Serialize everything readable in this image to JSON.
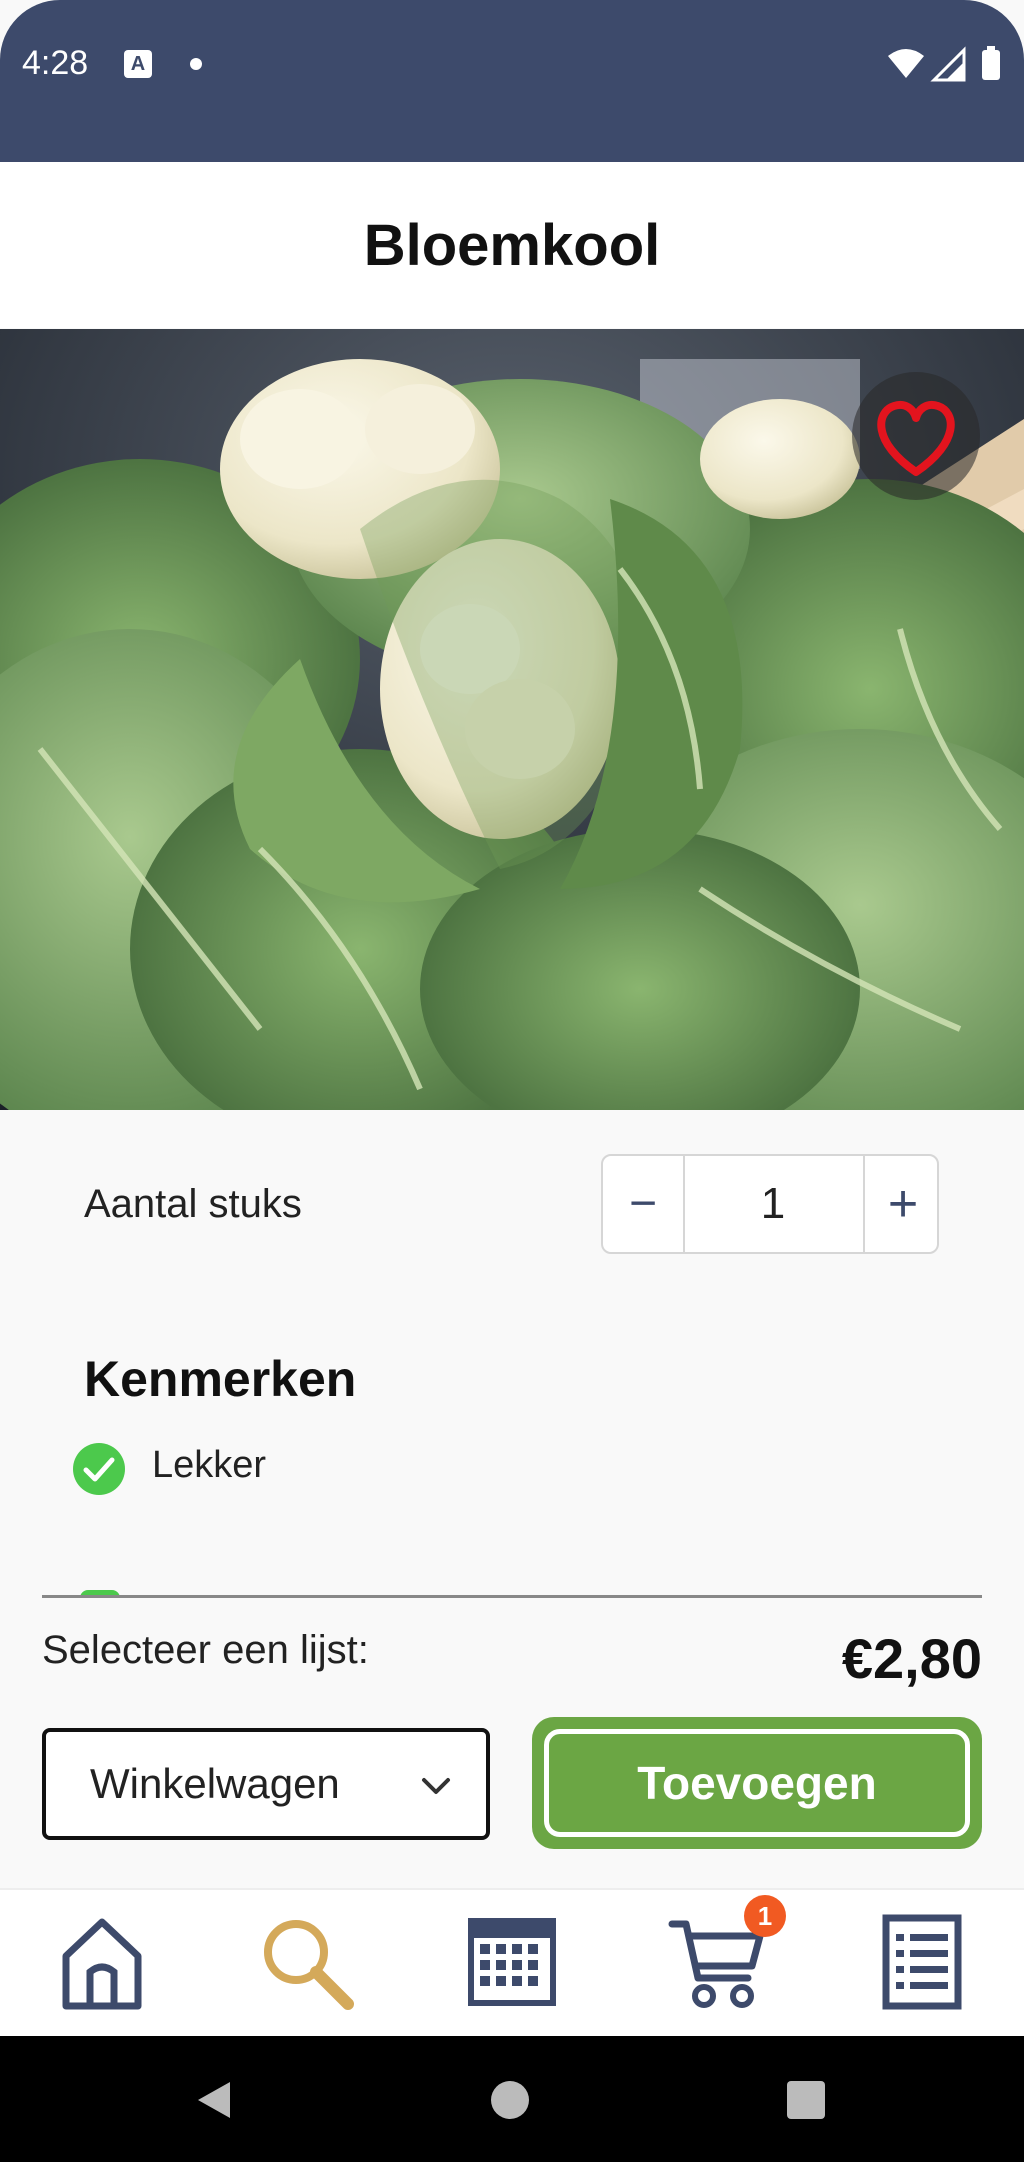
{
  "status_bar": {
    "time": "4:28",
    "notification_letter": "A"
  },
  "product": {
    "title": "Bloemkool",
    "quantity_label": "Aantal stuks",
    "quantity": "1",
    "features_heading": "Kenmerken",
    "features": [
      "Lekker"
    ],
    "price": "€2,80"
  },
  "stepper": {
    "minus": "−",
    "plus": "+"
  },
  "list_select": {
    "label": "Selecteer een lijst:",
    "value": "Winkelwagen"
  },
  "add_button": {
    "label": "Toevoegen"
  },
  "bottom_nav": {
    "items": [
      {
        "icon": "home-icon",
        "active": false
      },
      {
        "icon": "search-icon",
        "active": true
      },
      {
        "icon": "calendar-icon",
        "active": false
      },
      {
        "icon": "cart-icon",
        "active": false,
        "badge": "1"
      },
      {
        "icon": "list-icon",
        "active": false
      }
    ]
  },
  "colors": {
    "primary": "#3d4a6b",
    "accent_green": "#6ba644",
    "active_nav": "#d4a95a",
    "favorite_red": "#e3141e",
    "badge": "#f15a22",
    "check_green": "#4cc94c"
  }
}
